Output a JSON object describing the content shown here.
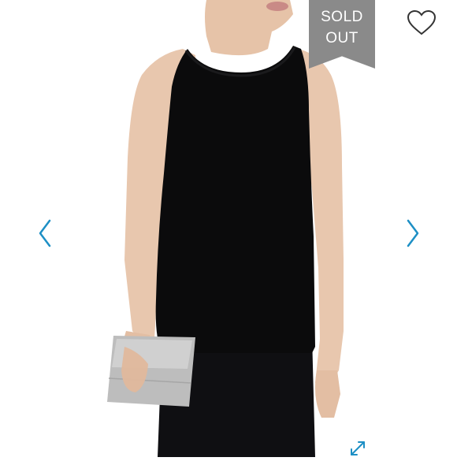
{
  "badge": {
    "line1": "SOLD",
    "line2": "OUT"
  },
  "icons": {
    "favorite": "heart-outline-icon",
    "previous": "chevron-left-icon",
    "next": "chevron-right-icon",
    "expand": "expand-arrows-icon"
  },
  "colors": {
    "badge_bg": "#8a8a8a",
    "accent": "#1d8fc5",
    "heart": "#333333"
  }
}
